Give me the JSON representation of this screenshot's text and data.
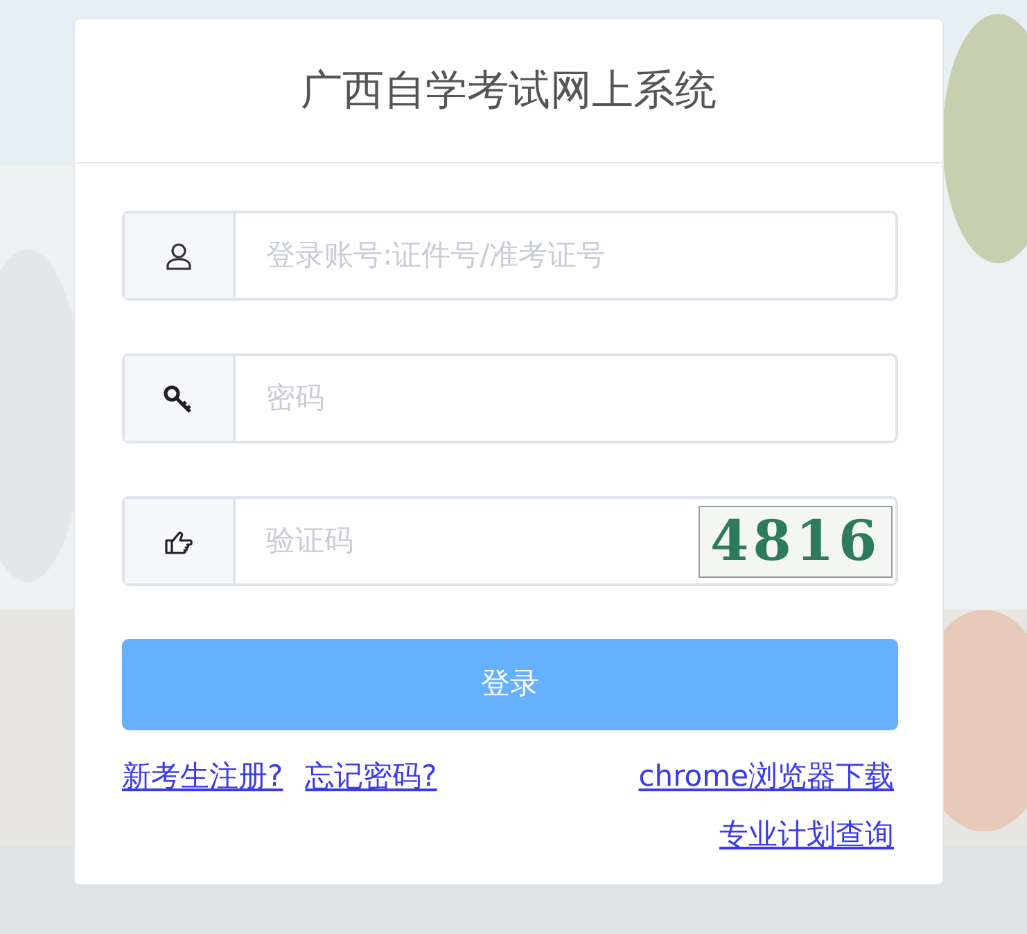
{
  "title": "广西自学考试网上系统",
  "fields": [
    {
      "kind": "account",
      "placeholder": "登录账号:证件号/准考证号"
    },
    {
      "kind": "password",
      "placeholder": "密码"
    },
    {
      "kind": "captcha",
      "placeholder": "验证码",
      "captcha": "4816"
    }
  ],
  "login_button": "登录",
  "links_left": [
    "新考生注册?",
    "忘记密码?"
  ],
  "links_right": [
    "chrome浏览器下载",
    "专业计划查询"
  ]
}
